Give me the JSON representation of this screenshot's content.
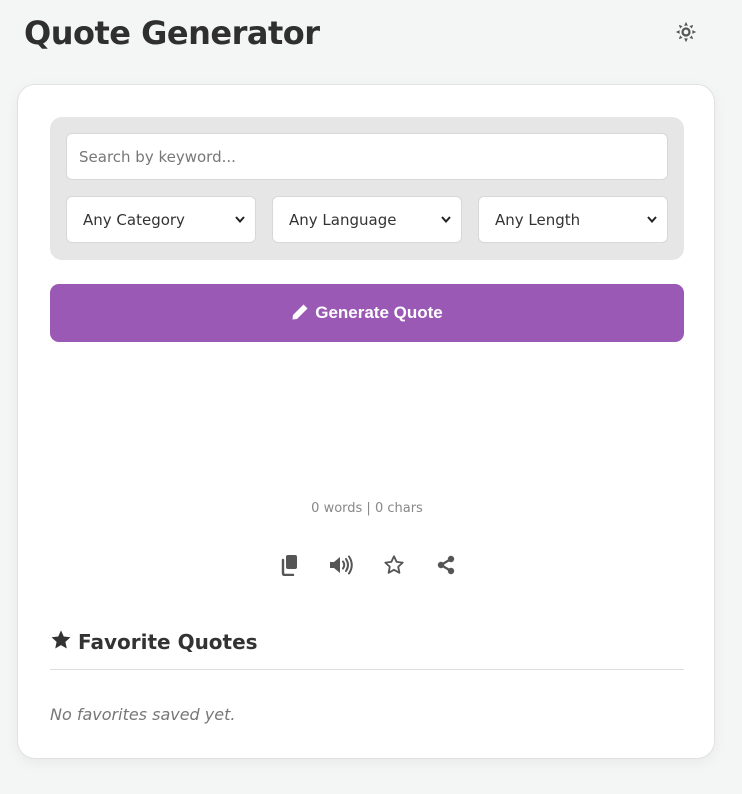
{
  "header": {
    "title": "Quote Generator",
    "theme_icon": "sun-icon"
  },
  "filters": {
    "search_placeholder": "Search by keyword...",
    "search_value": "",
    "category": {
      "selected": "Any Category"
    },
    "language": {
      "selected": "Any Language"
    },
    "length": {
      "selected": "Any Length"
    }
  },
  "generate": {
    "label": "Generate Quote",
    "icon": "pencil-icon"
  },
  "stats": {
    "counter": "0 words | 0 chars"
  },
  "actions": [
    {
      "icon": "copy-icon"
    },
    {
      "icon": "speaker-icon"
    },
    {
      "icon": "star-outline-icon"
    },
    {
      "icon": "share-icon"
    }
  ],
  "favorites": {
    "title": "Favorite Quotes",
    "icon": "star-icon",
    "empty_message": "No favorites saved yet."
  },
  "colors": {
    "accent": "#9b59b6",
    "background": "#f4f5f5",
    "card": "#ffffff",
    "filter_panel": "#e6e6e6",
    "icon": "#555555"
  }
}
